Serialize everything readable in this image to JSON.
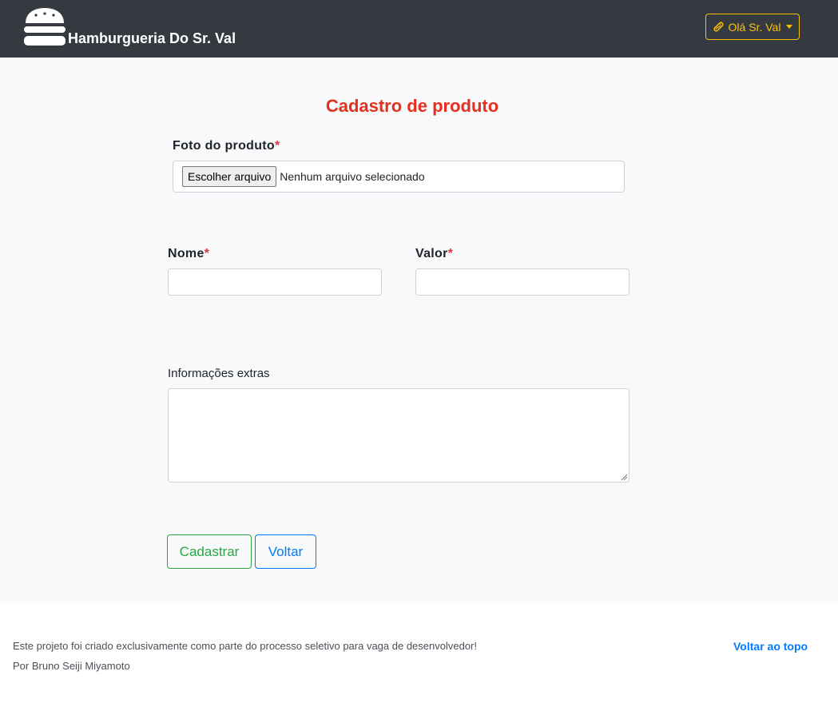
{
  "header": {
    "brand": "Hamburgueria Do Sr. Val",
    "user_menu": "Olá Sr. Val",
    "icons": {
      "brand": "hamburger-icon",
      "user": "hotdog-icon",
      "menu": "caret-down-icon"
    },
    "colors": {
      "bar": "#343a40",
      "accent": "#ffc107"
    }
  },
  "form": {
    "title": "Cadastro de produto",
    "required_mark": "*",
    "photo": {
      "label": "Foto do produto",
      "button": "Escolher arquivo",
      "status": "Nenhum arquivo selecionado"
    },
    "name": {
      "label": "Nome",
      "value": ""
    },
    "price": {
      "label": "Valor",
      "value": ""
    },
    "extras": {
      "label": "Informações extras",
      "value": ""
    },
    "submit": "Cadastrar",
    "back": "Voltar",
    "colors": {
      "title": "#e3301f",
      "submit": "#28a745",
      "back": "#007bff",
      "required": "#dc3545"
    }
  },
  "footer": {
    "line1": "Este projeto foi criado exclusivamente como parte do processo seletivo para vaga de desenvolvedor!",
    "line2": "Por Bruno Seiji Miyamoto",
    "back_to_top": "Voltar ao topo"
  }
}
